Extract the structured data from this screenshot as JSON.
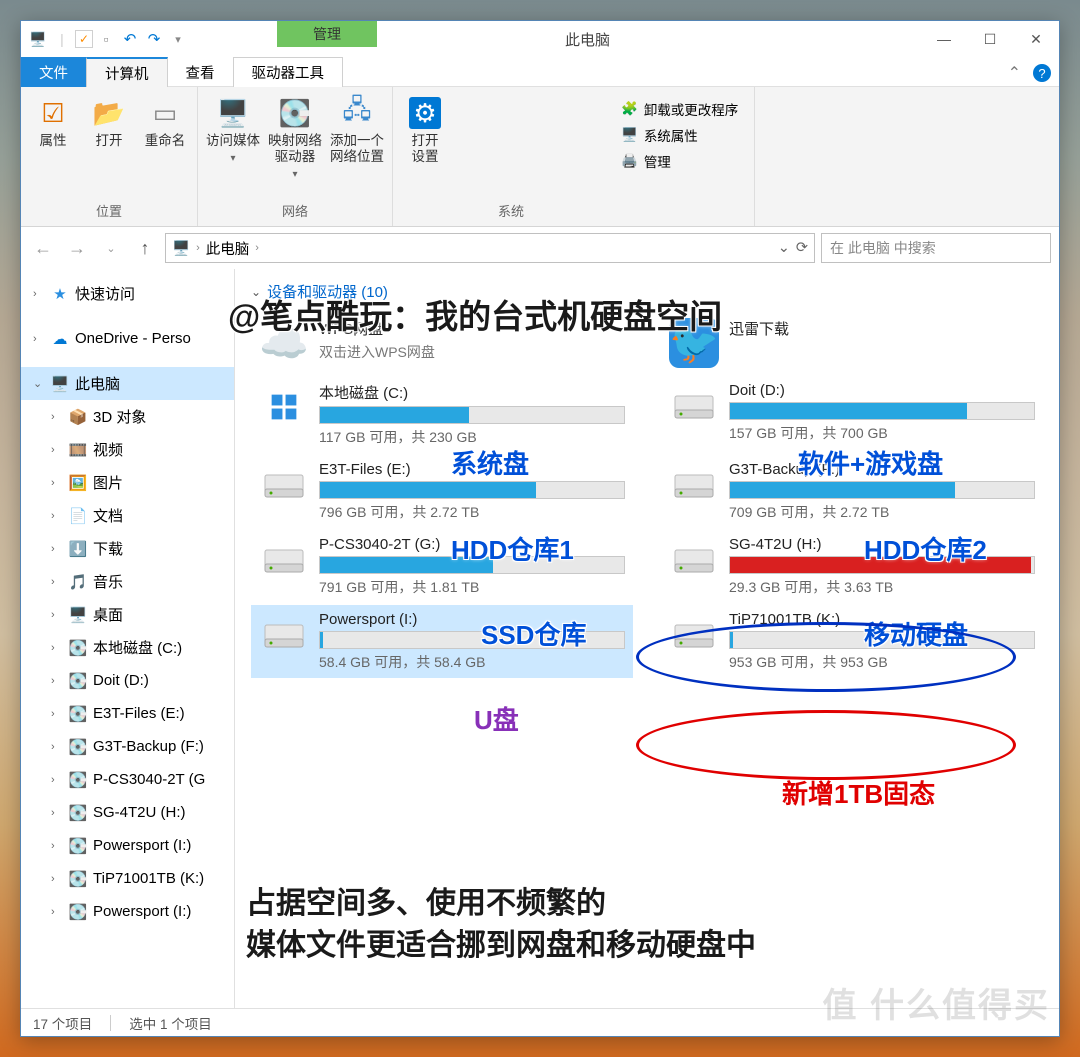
{
  "window": {
    "title": "此电脑",
    "manage_tab": "管理"
  },
  "wincontrols": {
    "min": "—",
    "max": "☐",
    "close": "✕"
  },
  "menutabs": {
    "file": "文件",
    "computer": "计算机",
    "view": "查看",
    "drivetools": "驱动器工具"
  },
  "ribbon": {
    "location": {
      "label": "位置",
      "props": "属性",
      "open": "打开",
      "rename": "重命名"
    },
    "network": {
      "label": "网络",
      "media": "访问媒体",
      "mapdrv": "映射网络\n驱动器",
      "addloc": "添加一个\n网络位置"
    },
    "system": {
      "label": "系统",
      "opensettings": "打开\n设置",
      "uninstall": "卸载或更改程序",
      "sysprops": "系统属性",
      "manage": "管理"
    }
  },
  "addr": {
    "path": "此电脑",
    "search_placeholder": "在 此电脑 中搜索"
  },
  "sidebar": {
    "quick": "快速访问",
    "onedrive": "OneDrive - Perso",
    "thispc": "此电脑",
    "items": [
      {
        "ico": "📦",
        "label": "3D 对象"
      },
      {
        "ico": "🎞️",
        "label": "视频"
      },
      {
        "ico": "🖼️",
        "label": "图片"
      },
      {
        "ico": "📄",
        "label": "文档"
      },
      {
        "ico": "⬇️",
        "label": "下载"
      },
      {
        "ico": "🎵",
        "label": "音乐"
      },
      {
        "ico": "🖥️",
        "label": "桌面"
      },
      {
        "ico": "💽",
        "label": "本地磁盘 (C:)"
      },
      {
        "ico": "💽",
        "label": "Doit (D:)"
      },
      {
        "ico": "💽",
        "label": "E3T-Files (E:)"
      },
      {
        "ico": "💽",
        "label": "G3T-Backup (F:)"
      },
      {
        "ico": "💽",
        "label": "P-CS3040-2T (G"
      },
      {
        "ico": "💽",
        "label": "SG-4T2U (H:)"
      },
      {
        "ico": "💽",
        "label": "Powersport (I:)"
      },
      {
        "ico": "💽",
        "label": "TiP71001TB (K:)"
      },
      {
        "ico": "💽",
        "label": "Powersport (I:)"
      }
    ]
  },
  "content": {
    "section": "设备和驱动器 (10)",
    "apps": [
      {
        "name": "WPS网盘",
        "sub": "双击进入WPS网盘",
        "ico": "☁️",
        "color": "#2b8fe0"
      },
      {
        "name": "迅雷下载",
        "sub": "",
        "ico": "🐦",
        "color": "#2b8fe0"
      }
    ],
    "drives": [
      {
        "name": "本地磁盘 (C:)",
        "free": "117 GB 可用",
        "total": "共 230 GB",
        "pct": 49,
        "mark": "win"
      },
      {
        "name": "Doit (D:)",
        "free": "157 GB 可用",
        "total": "共 700 GB",
        "pct": 78
      },
      {
        "name": "E3T-Files (E:)",
        "free": "796 GB 可用",
        "total": "共 2.72 TB",
        "pct": 71
      },
      {
        "name": "G3T-Backup (F:)",
        "free": "709 GB 可用",
        "total": "共 2.72 TB",
        "pct": 74
      },
      {
        "name": "P-CS3040-2T (G:)",
        "free": "791 GB 可用",
        "total": "共 1.81 TB",
        "pct": 57
      },
      {
        "name": "SG-4T2U (H:)",
        "free": "29.3 GB 可用",
        "total": "共 3.63 TB",
        "pct": 99,
        "red": true
      },
      {
        "name": "Powersport (I:)",
        "free": "58.4 GB 可用",
        "total": "共 58.4 GB",
        "pct": 1,
        "selected": true
      },
      {
        "name": "TiP71001TB (K:)",
        "free": "953 GB 可用",
        "total": "共 953 GB",
        "pct": 1
      }
    ]
  },
  "status": {
    "items": "17 个项目",
    "selected": "选中 1 个项目"
  },
  "annotations": {
    "title": "@笔点酷玩：我的台式机硬盘空间",
    "c": "系统盘",
    "d": "软件+游戏盘",
    "e": "HDD仓库1",
    "f": "HDD仓库2",
    "g": "SSD仓库",
    "h": "移动硬盘",
    "i": "U盘",
    "k": "新增1TB固态",
    "body1": "占据空间多、使用不频繁的",
    "body2": "媒体文件更适合挪到网盘和移动硬盘中"
  },
  "watermark": "值 什么值得买"
}
